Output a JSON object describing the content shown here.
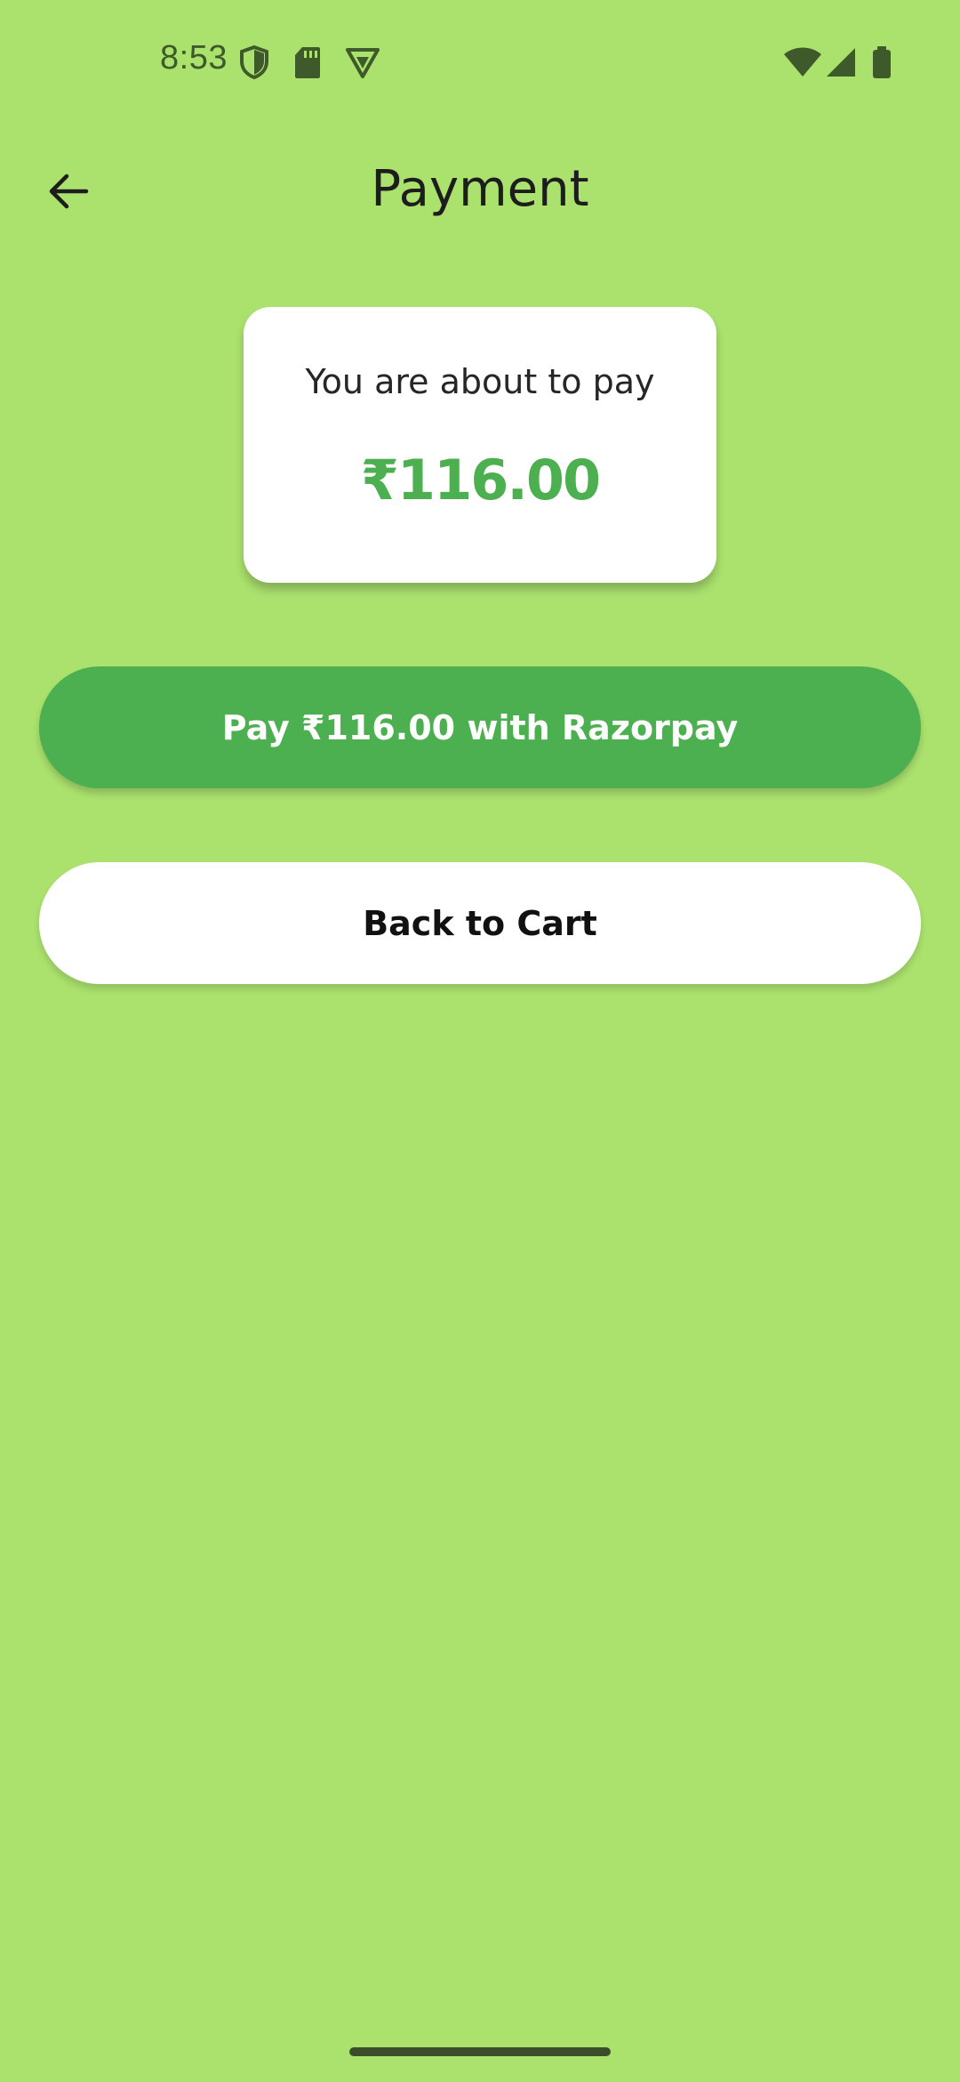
{
  "status_bar": {
    "time": "8:53",
    "icons_left": [
      "shield-icon",
      "sd-card-icon",
      "vpn-icon"
    ],
    "icons_right": [
      "wifi-icon",
      "signal-icon",
      "battery-icon"
    ],
    "icon_color": "#3f5a2a"
  },
  "app_bar": {
    "back_icon": "arrow-left-icon",
    "title": "Payment"
  },
  "summary": {
    "label": "You are about to pay",
    "amount": "₹116.00"
  },
  "actions": {
    "pay_label": "Pay ₹116.00 with Razorpay",
    "back_to_cart_label": "Back to Cart"
  },
  "colors": {
    "background": "#abe26e",
    "accent": "#4caf50",
    "card": "#ffffff"
  }
}
